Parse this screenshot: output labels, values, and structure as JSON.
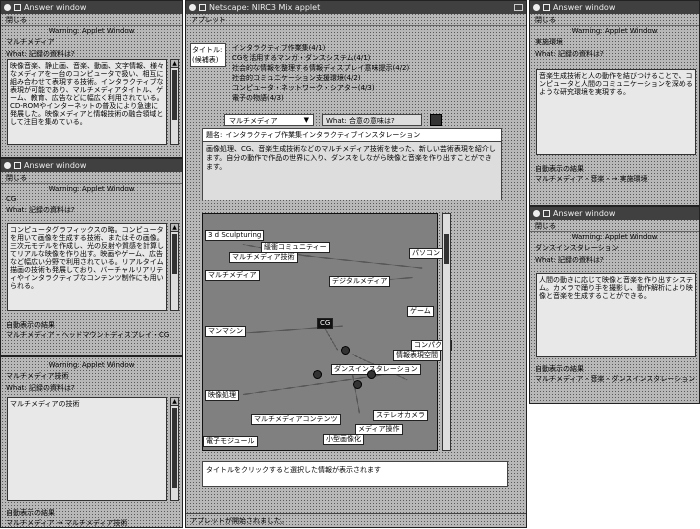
{
  "left_top": {
    "title": "Answer window",
    "menu": "閉じる",
    "warning": "Warning: Applet Window",
    "heading": "マルチメディア",
    "what_line": "What: 記録の資料は?",
    "body": "映像音楽、静止画、音楽、動画、文字情報、様々なメディアを一台のコンピュータで扱い、相互に組み合わせて表現する技術。インタラクティブな表現が可能であり、マルチメディアタイトル、ゲーム、教育、広告などに幅広く利用されている。CD-ROMやインターネットの普及により急速に発展した。映像メディアと情報技術の融合領域として注目を集めている。"
  },
  "left_mid": {
    "title": "Answer window",
    "menu": "閉じる",
    "warning": "Warning: Applet Window",
    "heading": "CG",
    "what_line": "What: 記録の資料は?",
    "body": "コンピュータグラフィックスの略。コンピュータを用いて画像を生成する技術、またはその画像。三次元モデルを作成し、光の反射や質感を計算してリアルな映像を作り出す。映画やゲーム、広告など幅広い分野で利用されている。リアルタイム描画の技術も発展しており、バーチャルリアリティやインタラクティブなコンテンツ制作にも用いられる。",
    "footer_label": "自動表示の結果",
    "footer_value": "マルチメディア・ヘッドマウントディスプレイ・CG"
  },
  "left_bot": {
    "warning": "Warning: Applet Window",
    "heading": "マルチメディア技術",
    "what_line": "What: 記録の資料は?",
    "box_text": "マルチメディアの技術",
    "footer_label": "自動表示の結果",
    "footer_value": "マルチメディア → マルチメディア技術"
  },
  "main": {
    "title": "Netscape: NIRC3 Mix applet",
    "menu": "アプレット",
    "title_label": "タイトル:",
    "title_label2": "(候補表)",
    "title_list": [
      "インタラクティブ作業集(4/1)",
      "CGを活用するマンガ・ダンスシステム(4/1)",
      "社会的な情報を整理する情報ディスプレイ意味提示(4/2)",
      "社会的コミュニケーション支援環境(4/2)",
      "コンピュータ・ネットワーク・シアター(4/3)",
      "電子の物語(4/3)"
    ],
    "dropdown1": "マルチメディア",
    "dropdown2_label": "What:",
    "dropdown2": "合意の意味は?",
    "desc_label": "題名:",
    "desc_title": "インタラクティブ作業集インタラクティブインスタレーション",
    "desc_body": "画像処理、CG、音楽生成技術などのマルチメディア技術を使った、新しい芸術表現を紹介します。自分の動作で作品の世界に入り、ダンスをしながら映像と音楽を作り出すことができます。",
    "nodes": [
      "3 d Sculpturing",
      "緩衝コミュニティー",
      "マルチメディア技術",
      "パソコン",
      "デジタルメディア",
      "ゲーム",
      "CG",
      "ダンスインスタレーション",
      "コンパクト",
      "情報表現空間",
      "映像処理",
      "マルチメディアコンテンツ",
      "ステレオカメラ",
      "メディア操作",
      "小型画像化",
      "電子モジュール",
      "マルチメディア",
      "マンマシン"
    ],
    "status_text": "タイトルをクリックすると選択した情報が表示されます",
    "bottom_status": "アプレットが開始されました。"
  },
  "right_top": {
    "title": "Answer window",
    "menu": "閉じる",
    "warning": "Warning: Applet Window",
    "heading": "実施環境",
    "what_line": "What: 記録の資料は?",
    "body": "音楽生成技術と人の動作を結びつけることで、コンピュータと人間のコミュニケーションを深めるような研究環境を実現する。",
    "footer_label": "自動表示の結果",
    "footer_value": "マルチメディア・音楽・→ 実施環境"
  },
  "right_bot": {
    "title": "Answer window",
    "menu": "閉じる",
    "warning": "Warning: Applet Window",
    "heading": "ダンスインスタレーション",
    "what_line": "What: 記録の資料は?",
    "body": "人間の動きに応じて映像と音楽を作り出すシステム。カメラで踊り手を撮影し、動作解析により映像と音楽を生成することができる。",
    "footer_label": "自動表示の結果",
    "footer_value": "マルチメディア・音楽・ダンスインスタレーション"
  }
}
